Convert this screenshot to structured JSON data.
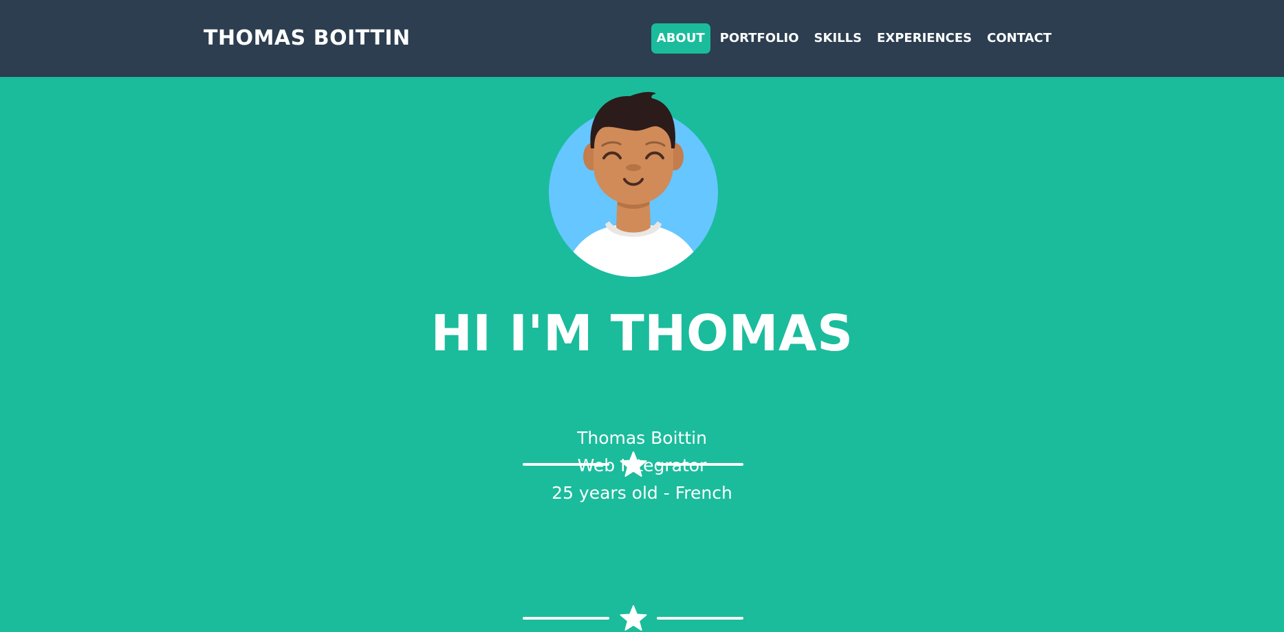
{
  "navbar": {
    "brand": "THOMAS BOITTIN",
    "links": [
      {
        "label": "ABOUT",
        "active": true
      },
      {
        "label": "PORTFOLIO",
        "active": false
      },
      {
        "label": "SKILLS",
        "active": false
      },
      {
        "label": "EXPERIENCES",
        "active": false
      },
      {
        "label": "CONTACT",
        "active": false
      }
    ]
  },
  "hero": {
    "title": "HI I'M THOMAS",
    "info": {
      "name": "Thomas Boittin",
      "role": "Web Integrator",
      "details": "25 years old - French"
    },
    "avatar_icon": "avatar-illustration",
    "divider_icon": "star-icon"
  },
  "colors": {
    "navbar": "#2c3e50",
    "primary": "#1abc9c",
    "text": "#ffffff",
    "avatar_background": "#66c6ff"
  }
}
